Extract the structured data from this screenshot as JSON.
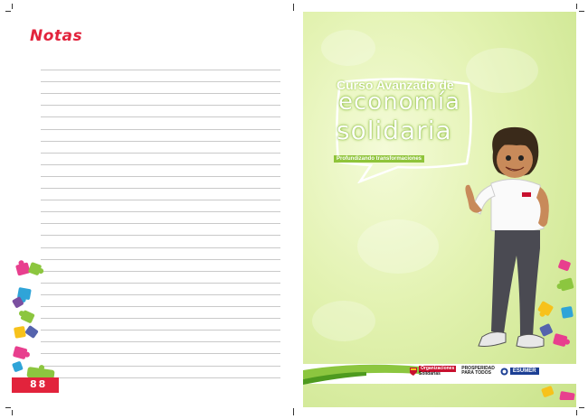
{
  "left_page": {
    "title": "Notas",
    "page_number": "88",
    "rule_count": 27
  },
  "right_page": {
    "course_logo": {
      "line1": "Curso Avanzado de",
      "line2": "economía",
      "line3": "solidaria",
      "tagline": "Profundizando transformaciones"
    },
    "footer_logos": {
      "org1_line1": "Organizaciones",
      "org1_line2": "Solidarias",
      "org2_line1": "PROSPERIDAD",
      "org2_line2": "PARA TODOS",
      "org3": "ESUMER"
    }
  },
  "colors": {
    "accent_red": "#e2233c",
    "green_bg": "#dcefa6",
    "rule": "#c9c9c9"
  },
  "icons": [
    "puzzle-pieces-decoration",
    "mascot-thumbs-up",
    "colombia-shield-icon",
    "esumer-logo"
  ]
}
